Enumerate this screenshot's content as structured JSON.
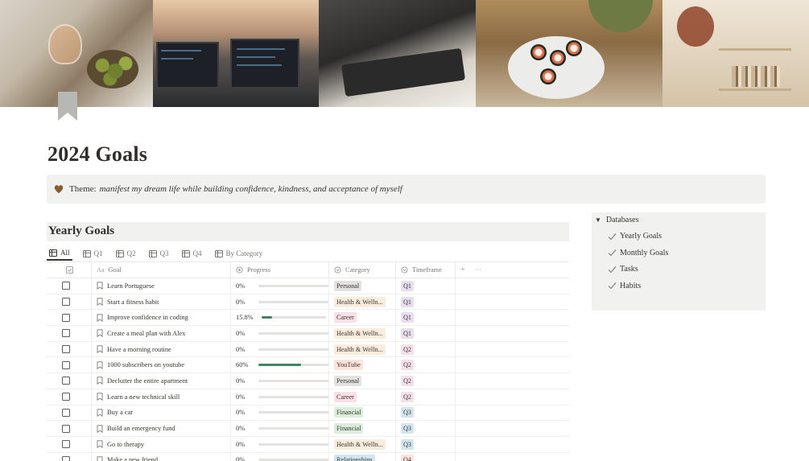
{
  "page": {
    "title": "2024 Goals",
    "callout": {
      "icon": "brown-heart-icon",
      "label": "Theme:",
      "text": "manifest my dream life while building confidence, kindness, and acceptance of myself"
    }
  },
  "database": {
    "title": "Yearly Goals",
    "tabs": [
      {
        "label": "All",
        "icon": "table-icon",
        "active": true
      },
      {
        "label": "Q1",
        "icon": "table-icon"
      },
      {
        "label": "Q2",
        "icon": "table-icon"
      },
      {
        "label": "Q3",
        "icon": "table-icon"
      },
      {
        "label": "Q4",
        "icon": "table-icon"
      },
      {
        "label": "By Category",
        "icon": "table-icon"
      }
    ],
    "columns": {
      "goal": "Goal",
      "progress": "Progress",
      "category": "Category",
      "timeframe": "Timeframe",
      "add": "+",
      "more": "···"
    },
    "rows": [
      {
        "goal": "Learn Portuguese",
        "progress_label": "0%",
        "progress": 0,
        "category": "Personal",
        "cat_class": "personal",
        "timeframe": "Q1"
      },
      {
        "goal": "Start a fitness habit",
        "progress_label": "0%",
        "progress": 0,
        "category": "Health & Welln...",
        "cat_class": "health",
        "timeframe": "Q1"
      },
      {
        "goal": "Improve confidence in coding",
        "progress_label": "15.8%",
        "progress": 0.158,
        "category": "Career",
        "cat_class": "career",
        "timeframe": "Q1"
      },
      {
        "goal": "Create a meal plan with Alex",
        "progress_label": "0%",
        "progress": 0,
        "category": "Health & Welln...",
        "cat_class": "health",
        "timeframe": "Q1"
      },
      {
        "goal": "Have a morning routine",
        "progress_label": "0%",
        "progress": 0,
        "category": "Health & Welln...",
        "cat_class": "health",
        "timeframe": "Q2"
      },
      {
        "goal": "1000 subscribers on youtube",
        "progress_label": "60%",
        "progress": 0.6,
        "category": "YouTube",
        "cat_class": "youtube",
        "timeframe": "Q2"
      },
      {
        "goal": "Declutter the entire apartment",
        "progress_label": "0%",
        "progress": 0,
        "category": "Personal",
        "cat_class": "personal",
        "timeframe": "Q2"
      },
      {
        "goal": "Learn a new technical skill",
        "progress_label": "0%",
        "progress": 0,
        "category": "Career",
        "cat_class": "career",
        "timeframe": "Q2"
      },
      {
        "goal": "Buy a car",
        "progress_label": "0%",
        "progress": 0,
        "category": "Financial",
        "cat_class": "financial",
        "timeframe": "Q3"
      },
      {
        "goal": "Build an emergency fund",
        "progress_label": "0%",
        "progress": 0,
        "category": "Financial",
        "cat_class": "financial",
        "timeframe": "Q3"
      },
      {
        "goal": "Go to therapy",
        "progress_label": "0%",
        "progress": 0,
        "category": "Health & Welln...",
        "cat_class": "health",
        "timeframe": "Q3"
      },
      {
        "goal": "Make a new friend",
        "progress_label": "0%",
        "progress": 0,
        "category": "Relationships",
        "cat_class": "relationships",
        "timeframe": "Q4"
      }
    ]
  },
  "sidebar": {
    "title": "Databases",
    "items": [
      {
        "label": "Yearly Goals"
      },
      {
        "label": "Monthly Goals"
      },
      {
        "label": "Tasks"
      },
      {
        "label": "Habits"
      }
    ]
  },
  "colors": {
    "progress_fill": "#448361",
    "callout_bg": "#f1f1ef"
  }
}
